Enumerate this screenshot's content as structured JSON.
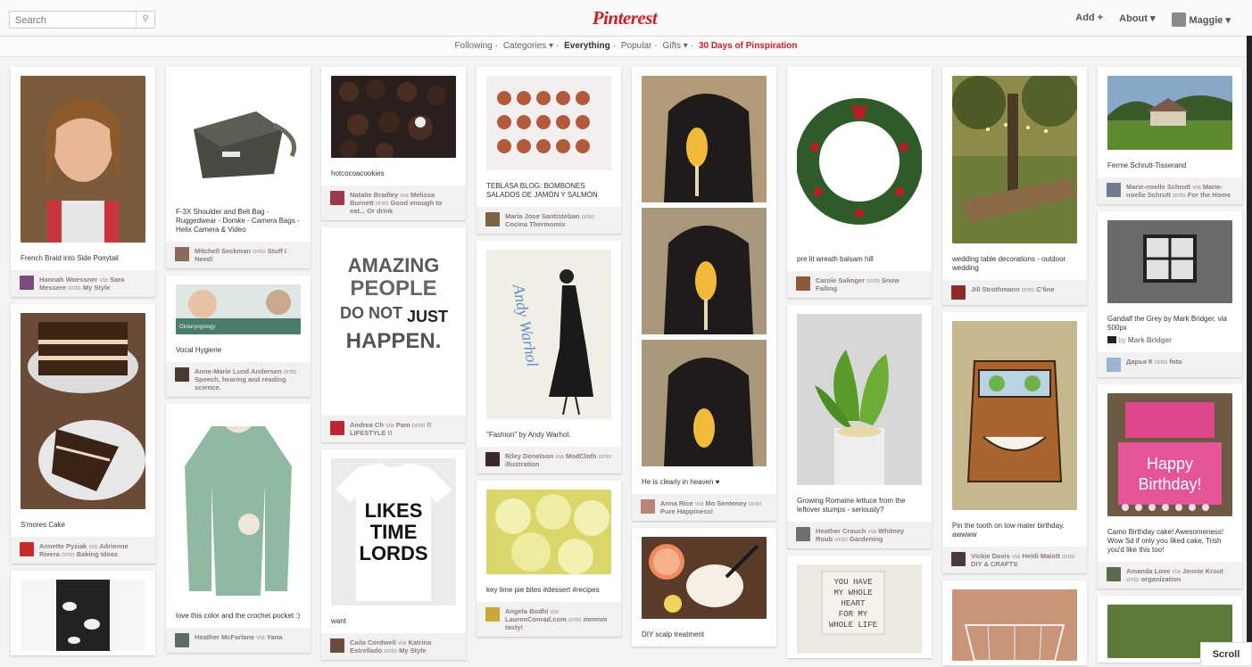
{
  "header": {
    "search_placeholder": "Search",
    "logo": "Pinterest",
    "add": "Add +",
    "about": "About ▾",
    "user": "Maggie ▾"
  },
  "subnav": {
    "following": "Following",
    "categories": "Categories ▾",
    "everything": "Everything",
    "popular": "Popular",
    "gifts": "Gifts ▾",
    "pinspiration": "30 Days of Pinspiration"
  },
  "pins": {
    "c1p1": {
      "caption": "French Braid into Side Ponytail",
      "user": "Hannah Woessner",
      "via": "via",
      "src": "Sara Messere",
      "onto": "onto",
      "board": "My Style"
    },
    "c1p2": {
      "caption": "S'mores Cake",
      "user": "Annette Pyziak",
      "via": "via",
      "src": "Adrienne Rivera",
      "onto": "onto",
      "board": "Baking Ideas"
    },
    "c2p1": {
      "caption": "F-3X Shoulder and Belt Bag - Ruggedwear - Domke - Camera Bags - Helix Camera & Video",
      "user": "Mitchell Seckman",
      "onto": "onto",
      "board": "Stuff I Need!"
    },
    "c2p2": {
      "caption": "Vocal Hygiene",
      "user": "Anne-Marie Lund Andersen",
      "onto": "onto",
      "board": "Speech, hearing and reading science.",
      "img_text": "Otolaryngology"
    },
    "c2p3": {
      "caption": "love this color and the crochet pocket :)",
      "user": "Heather McFarlane",
      "via": "via",
      "src": "Yana"
    },
    "c3p1": {
      "caption": "hotcocoacookies",
      "user": "Natalie Bradley",
      "via": "via",
      "src": "Melissa Burnett",
      "onto": "onto",
      "board": "Good enough to eat... Or drink"
    },
    "c3p2": {
      "caption": "",
      "user": "Andrea Ch",
      "via": "via",
      "src": "Pam",
      "onto": "onto",
      "board": "!! LIFESTYLE !!",
      "img_lines": [
        "AMAZING",
        "PEOPLE",
        "DO NOT",
        "JUST",
        "HAPPEN."
      ]
    },
    "c3p3": {
      "caption": "want",
      "user": "Caila Cordwell",
      "via": "via",
      "src": "Katrina Estrellado",
      "onto": "onto",
      "board": "My Style",
      "img_lines": [
        "LIKES",
        "TIME",
        "LORDS"
      ]
    },
    "c4p1": {
      "caption": "TEBLASA BLOG: BOMBONES SALADOS DE JAMÓN Y SALMÓN",
      "user": "Maria Jose Santisteban",
      "onto": "onto",
      "board": "Cocina Thermomix"
    },
    "c4p2": {
      "caption": "\"Fashion\" by Andy Warhol.",
      "user": "Riley Donelson",
      "via": "via",
      "src": "ModCloth",
      "onto": "onto",
      "board": "illustration",
      "img_text": "Andy Warhol"
    },
    "c4p3": {
      "caption": "key lime pie bites #dessert #recipes",
      "user": "Angela Bodhi",
      "via": "via",
      "src": "LaurenConrad.com",
      "onto": "onto",
      "board": "mmmm tasty!"
    },
    "c5p1": {
      "caption": "He is clearly in heaven ♥",
      "user": "Anna Rice",
      "via": "via",
      "src": "Mo Senteney",
      "onto": "onto",
      "board": "Pure Happiness!"
    },
    "c5p2": {
      "caption": "DIY scalp treatment"
    },
    "c6p1": {
      "caption": "pre lit wreath balsam hill",
      "user": "Carole Salinger",
      "onto": "onto",
      "board": "Snow Falling"
    },
    "c6p2": {
      "caption": "Growing Romaine lettuce from the leftover stumps - seriously?",
      "user": "Heather Crouch",
      "via": "via",
      "src": "Whitney Roub",
      "onto": "onto",
      "board": "Gardening"
    },
    "c6p3": {
      "caption": "",
      "img_lines": [
        "YOU HAVE",
        "MY WHOLE",
        "HEART",
        "FOR MY",
        "WHOLE LIFE"
      ]
    },
    "c7p1": {
      "caption": "wedding table decorations - outdoor wedding",
      "user": "Jill Strothmann",
      "onto": "onto",
      "board": "C'line"
    },
    "c7p2": {
      "caption": "Pin the tooth on tow mater birthday. awwww",
      "user": "Vickie Davis",
      "via": "via",
      "src": "Heidi Malott",
      "onto": "onto",
      "board": "DIY & CRAFTS"
    },
    "c8p1": {
      "caption": "Ferme Schrutt-Tisserand",
      "user": "Marie-noelle Schrutt",
      "via": "via",
      "src": "Marie-noelle Schrutt",
      "onto": "onto",
      "board": "For the Home"
    },
    "c8p2": {
      "caption": "Gandalf the Grey by Mark Bridger, via 500px",
      "by": "by",
      "src": "Mark Bridger",
      "user": "Дарья К",
      "onto": "onto",
      "board": "foto"
    },
    "c8p3": {
      "caption": "Camo Birthday cake! Awesomeness! Wow Sd if only you liked cake, Trish you'd like this too!",
      "user": "Amanda Love",
      "via": "via",
      "src": "Jennie Krout",
      "onto": "onto",
      "board": "organization",
      "img_lines": [
        "Happy",
        "Birthday!"
      ]
    }
  },
  "scroll": "Scroll",
  "colors": {
    "accent": "#cb2027",
    "background": "#f4f2f2",
    "card": "#ffffff"
  }
}
